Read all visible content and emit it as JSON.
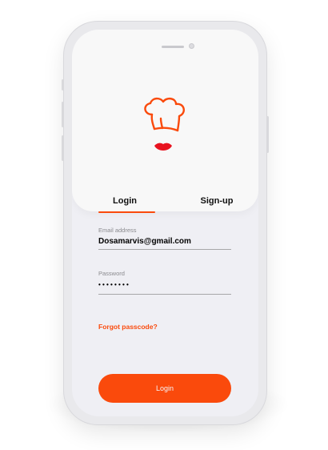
{
  "tabs": [
    {
      "label": "Login",
      "active": true
    },
    {
      "label": "Sign-up",
      "active": false
    }
  ],
  "email": {
    "label": "Email address",
    "value": "Dosamarvis@gmail.com"
  },
  "password": {
    "label": "Password",
    "masked_value": "••••••••"
  },
  "forgot_link": "Forgot passcode?",
  "login_button": "Login",
  "logo_icon": "chef-hat-icon",
  "colors": {
    "accent": "#FA4A0C",
    "background": "#EFEFF4",
    "header": "#F8F8F8"
  }
}
